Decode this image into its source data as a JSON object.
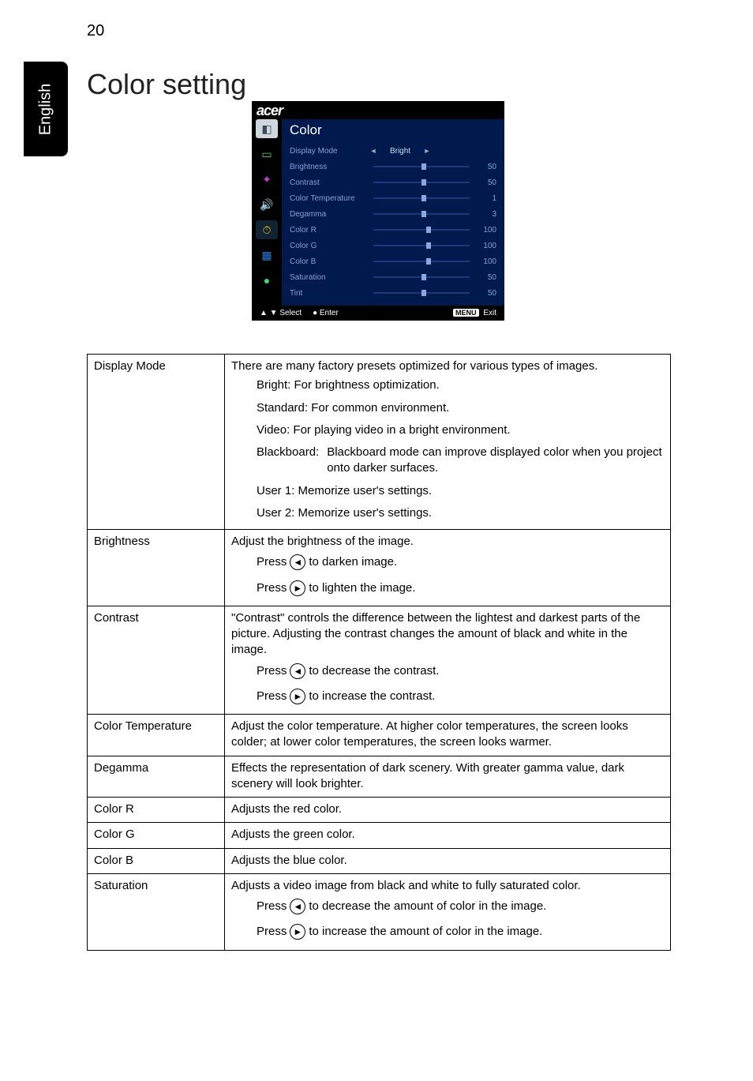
{
  "page_number": "20",
  "side_tab": "English",
  "heading": "Color setting",
  "menu": {
    "logo": "acer",
    "title": "Color",
    "rows": [
      {
        "label": "Display Mode",
        "type": "enum",
        "left_arrow": "◄",
        "value": "Bright",
        "right_arrow": "►"
      },
      {
        "label": "Brightness",
        "type": "slider",
        "pos": 50,
        "num": "50"
      },
      {
        "label": "Contrast",
        "type": "slider",
        "pos": 50,
        "num": "50"
      },
      {
        "label": "Color Temperature",
        "type": "slider",
        "pos": 50,
        "num": "1"
      },
      {
        "label": "Degamma",
        "type": "slider",
        "pos": 50,
        "num": "3"
      },
      {
        "label": "Color R",
        "type": "slider",
        "pos": 55,
        "num": "100"
      },
      {
        "label": "Color G",
        "type": "slider",
        "pos": 55,
        "num": "100"
      },
      {
        "label": "Color B",
        "type": "slider",
        "pos": 55,
        "num": "100"
      },
      {
        "label": "Saturation",
        "type": "slider",
        "pos": 50,
        "num": "50"
      },
      {
        "label": "Tint",
        "type": "slider",
        "pos": 50,
        "num": "50"
      }
    ],
    "footer_left_updown": "▲ ▼",
    "footer_select": "Select",
    "footer_enter_icon": "●",
    "footer_enter": "Enter",
    "footer_menu_kbd": "MENU",
    "footer_exit": "Exit"
  },
  "table": {
    "display_mode": {
      "key": "Display Mode",
      "intro": "There are many factory presets optimized for various types of images.",
      "bright": "Bright: For brightness optimization.",
      "standard": "Standard: For common environment.",
      "video": "Video: For playing video in a bright environment.",
      "blackboard_label": "Blackboard:",
      "blackboard_body": "Blackboard mode can improve displayed color when you project onto darker surfaces.",
      "user1": "User 1: Memorize user's settings.",
      "user2": "User 2: Memorize user's settings."
    },
    "brightness": {
      "key": "Brightness",
      "intro": "Adjust the brightness of the image.",
      "press": "Press",
      "darken": "to darken image.",
      "lighten": "to lighten the image."
    },
    "contrast": {
      "key": "Contrast",
      "intro": "\"Contrast\" controls the difference between the lightest and darkest parts of the picture. Adjusting the contrast changes the amount of black and white in the image.",
      "press": "Press",
      "decrease": "to decrease the contrast.",
      "increase": "to increase the contrast."
    },
    "color_temp": {
      "key": "Color Temperature",
      "body": "Adjust the color temperature. At higher color temperatures, the screen looks colder; at lower color temperatures, the screen looks warmer."
    },
    "degamma": {
      "key": "Degamma",
      "body": "Effects the representation of dark scenery. With greater gamma value, dark scenery will look brighter."
    },
    "color_r": {
      "key": "Color R",
      "body": "Adjusts the red color."
    },
    "color_g": {
      "key": "Color G",
      "body": "Adjusts the green color."
    },
    "color_b": {
      "key": "Color B",
      "body": "Adjusts the blue color."
    },
    "saturation": {
      "key": "Saturation",
      "intro": "Adjusts a video image from black and white to fully saturated color.",
      "press": "Press",
      "decrease": "to decrease the amount of color in the image.",
      "increase": "to increase the amount of color in the image."
    }
  },
  "arrows": {
    "left": "◄",
    "right": "►"
  }
}
